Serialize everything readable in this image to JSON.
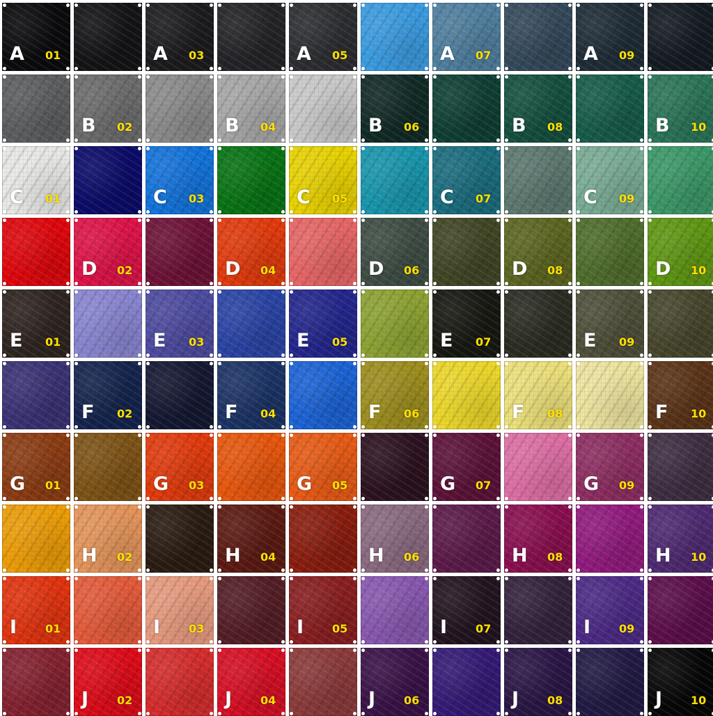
{
  "swatches": [
    {
      "letter": "A",
      "num": "01",
      "color": "#0b0b0d"
    },
    {
      "letter": "",
      "num": "",
      "color": "#141416"
    },
    {
      "letter": "A",
      "num": "03",
      "color": "#1c1c1f"
    },
    {
      "letter": "",
      "num": "",
      "color": "#242428"
    },
    {
      "letter": "A",
      "num": "05",
      "color": "#2d2e32"
    },
    {
      "letter": "",
      "num": "",
      "color": "#3a9be0"
    },
    {
      "letter": "A",
      "num": "07",
      "color": "#4f7f9f"
    },
    {
      "letter": "",
      "num": "",
      "color": "#34495b"
    },
    {
      "letter": "A",
      "num": "09",
      "color": "#1f2c37"
    },
    {
      "letter": "",
      "num": "",
      "color": "#141b22"
    },
    {
      "letter": "",
      "num": "",
      "color": "#5c5e60"
    },
    {
      "letter": "B",
      "num": "02",
      "color": "#6c6c6c"
    },
    {
      "letter": "",
      "num": "",
      "color": "#8b8b8b"
    },
    {
      "letter": "B",
      "num": "04",
      "color": "#a6a6a6"
    },
    {
      "letter": "",
      "num": "",
      "color": "#c8c8c8"
    },
    {
      "letter": "B",
      "num": "06",
      "color": "#112a26"
    },
    {
      "letter": "",
      "num": "",
      "color": "#0f3f34"
    },
    {
      "letter": "B",
      "num": "08",
      "color": "#14503f"
    },
    {
      "letter": "",
      "num": "",
      "color": "#165c49"
    },
    {
      "letter": "B",
      "num": "10",
      "color": "#2a7558"
    },
    {
      "letter": "C",
      "num": "01",
      "color": "#e8e8e6"
    },
    {
      "letter": "",
      "num": "",
      "color": "#0b0b6a"
    },
    {
      "letter": "C",
      "num": "03",
      "color": "#1273db"
    },
    {
      "letter": "",
      "num": "",
      "color": "#087414"
    },
    {
      "letter": "C",
      "num": "05",
      "color": "#e8d200"
    },
    {
      "letter": "",
      "num": "",
      "color": "#1896ad"
    },
    {
      "letter": "C",
      "num": "07",
      "color": "#1a6d7f"
    },
    {
      "letter": "",
      "num": "",
      "color": "#5d7870"
    },
    {
      "letter": "C",
      "num": "09",
      "color": "#79ac95"
    },
    {
      "letter": "",
      "num": "",
      "color": "#3b9868"
    },
    {
      "letter": "",
      "num": "",
      "color": "#e0060c"
    },
    {
      "letter": "D",
      "num": "02",
      "color": "#df1248"
    },
    {
      "letter": "",
      "num": "",
      "color": "#6e1238"
    },
    {
      "letter": "D",
      "num": "04",
      "color": "#e23a0c"
    },
    {
      "letter": "",
      "num": "",
      "color": "#e76565"
    },
    {
      "letter": "D",
      "num": "06",
      "color": "#3e4d44"
    },
    {
      "letter": "",
      "num": "",
      "color": "#414625"
    },
    {
      "letter": "D",
      "num": "08",
      "color": "#5c6620"
    },
    {
      "letter": "",
      "num": "",
      "color": "#4f6d2c"
    },
    {
      "letter": "D",
      "num": "10",
      "color": "#5f9712"
    },
    {
      "letter": "E",
      "num": "01",
      "color": "#2f2520"
    },
    {
      "letter": "",
      "num": "",
      "color": "#8885d0"
    },
    {
      "letter": "E",
      "num": "03",
      "color": "#4d4ba0"
    },
    {
      "letter": "",
      "num": "",
      "color": "#2a44a6"
    },
    {
      "letter": "E",
      "num": "05",
      "color": "#23268d"
    },
    {
      "letter": "",
      "num": "",
      "color": "#8ca232"
    },
    {
      "letter": "E",
      "num": "07",
      "color": "#181812"
    },
    {
      "letter": "",
      "num": "",
      "color": "#2b2c22"
    },
    {
      "letter": "E",
      "num": "09",
      "color": "#4f4f3a"
    },
    {
      "letter": "",
      "num": "",
      "color": "#47462c"
    },
    {
      "letter": "",
      "num": "",
      "color": "#3a3275"
    },
    {
      "letter": "F",
      "num": "02",
      "color": "#14244e"
    },
    {
      "letter": "",
      "num": "",
      "color": "#141832"
    },
    {
      "letter": "F",
      "num": "04",
      "color": "#1b3366"
    },
    {
      "letter": "",
      "num": "",
      "color": "#1b63d6"
    },
    {
      "letter": "F",
      "num": "06",
      "color": "#9d8e1e"
    },
    {
      "letter": "",
      "num": "",
      "color": "#ecd728"
    },
    {
      "letter": "F",
      "num": "08",
      "color": "#ece07a"
    },
    {
      "letter": "",
      "num": "",
      "color": "#ede49e"
    },
    {
      "letter": "F",
      "num": "10",
      "color": "#5b3418"
    },
    {
      "letter": "G",
      "num": "01",
      "color": "#8c3c12"
    },
    {
      "letter": "",
      "num": "",
      "color": "#7e5316"
    },
    {
      "letter": "G",
      "num": "03",
      "color": "#e23a0c"
    },
    {
      "letter": "",
      "num": "",
      "color": "#e8560c"
    },
    {
      "letter": "G",
      "num": "05",
      "color": "#e85a14"
    },
    {
      "letter": "",
      "num": "",
      "color": "#2c1220"
    },
    {
      "letter": "G",
      "num": "07",
      "color": "#5c1238"
    },
    {
      "letter": "",
      "num": "",
      "color": "#dd6ea4"
    },
    {
      "letter": "G",
      "num": "09",
      "color": "#8e2e62"
    },
    {
      "letter": "",
      "num": "",
      "color": "#3e2e42"
    },
    {
      "letter": "",
      "num": "",
      "color": "#ec9c06"
    },
    {
      "letter": "H",
      "num": "02",
      "color": "#e4945a"
    },
    {
      "letter": "",
      "num": "",
      "color": "#2a1c12"
    },
    {
      "letter": "H",
      "num": "04",
      "color": "#5c1a12"
    },
    {
      "letter": "",
      "num": "",
      "color": "#8a1d0e"
    },
    {
      "letter": "H",
      "num": "06",
      "color": "#8a6a80"
    },
    {
      "letter": "",
      "num": "",
      "color": "#5c1a4a"
    },
    {
      "letter": "H",
      "num": "08",
      "color": "#8a0e50"
    },
    {
      "letter": "",
      "num": "",
      "color": "#921a7e"
    },
    {
      "letter": "H",
      "num": "10",
      "color": "#4f2a72"
    },
    {
      "letter": "I",
      "num": "01",
      "color": "#e2330e"
    },
    {
      "letter": "",
      "num": "",
      "color": "#e45a3a"
    },
    {
      "letter": "I",
      "num": "03",
      "color": "#e69a7e"
    },
    {
      "letter": "",
      "num": "",
      "color": "#541e26"
    },
    {
      "letter": "I",
      "num": "05",
      "color": "#8a1e20"
    },
    {
      "letter": "",
      "num": "",
      "color": "#8858b0"
    },
    {
      "letter": "I",
      "num": "07",
      "color": "#221420"
    },
    {
      "letter": "",
      "num": "",
      "color": "#33223c"
    },
    {
      "letter": "I",
      "num": "09",
      "color": "#4c2a86"
    },
    {
      "letter": "",
      "num": "",
      "color": "#5c0e4a"
    },
    {
      "letter": "",
      "num": "",
      "color": "#842230"
    },
    {
      "letter": "J",
      "num": "02",
      "color": "#df0a18"
    },
    {
      "letter": "",
      "num": "",
      "color": "#d62c2c"
    },
    {
      "letter": "J",
      "num": "04",
      "color": "#d80e24"
    },
    {
      "letter": "",
      "num": "",
      "color": "#8c3a3a"
    },
    {
      "letter": "J",
      "num": "06",
      "color": "#3a1248"
    },
    {
      "letter": "",
      "num": "",
      "color": "#341a76"
    },
    {
      "letter": "J",
      "num": "08",
      "color": "#2a1646"
    },
    {
      "letter": "",
      "num": "",
      "color": "#221a44"
    },
    {
      "letter": "J",
      "num": "10",
      "color": "#060606"
    }
  ]
}
